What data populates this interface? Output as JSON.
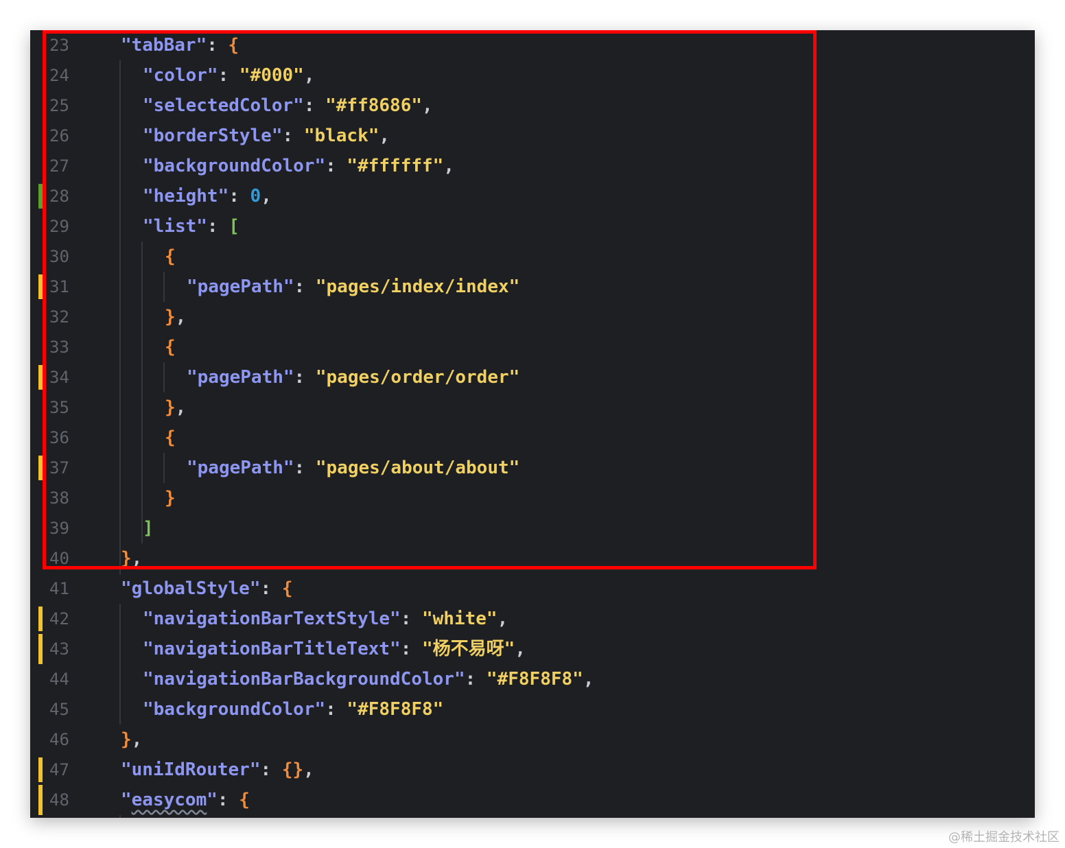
{
  "editor": {
    "lines": [
      {
        "num": "23",
        "indent": 0,
        "tokens": [
          {
            "t": "\"tabBar\"",
            "c": "k"
          },
          {
            "t": ": ",
            "c": "p"
          },
          {
            "t": "{",
            "c": "bc"
          }
        ]
      },
      {
        "num": "24",
        "indent": 1,
        "tokens": [
          {
            "t": "\"color\"",
            "c": "k"
          },
          {
            "t": ": ",
            "c": "p"
          },
          {
            "t": "\"#000\"",
            "c": "s"
          },
          {
            "t": ",",
            "c": "p"
          }
        ]
      },
      {
        "num": "25",
        "indent": 1,
        "tokens": [
          {
            "t": "\"selectedColor\"",
            "c": "k"
          },
          {
            "t": ": ",
            "c": "p"
          },
          {
            "t": "\"#ff8686\"",
            "c": "s"
          },
          {
            "t": ",",
            "c": "p"
          }
        ]
      },
      {
        "num": "26",
        "indent": 1,
        "tokens": [
          {
            "t": "\"borderStyle\"",
            "c": "k"
          },
          {
            "t": ": ",
            "c": "p"
          },
          {
            "t": "\"black\"",
            "c": "s"
          },
          {
            "t": ",",
            "c": "p"
          }
        ]
      },
      {
        "num": "27",
        "indent": 1,
        "tokens": [
          {
            "t": "\"backgroundColor\"",
            "c": "k"
          },
          {
            "t": ": ",
            "c": "p"
          },
          {
            "t": "\"#ffffff\"",
            "c": "s"
          },
          {
            "t": ",",
            "c": "p"
          }
        ]
      },
      {
        "num": "28",
        "indent": 1,
        "mark": "green",
        "tokens": [
          {
            "t": "\"height\"",
            "c": "k"
          },
          {
            "t": ": ",
            "c": "p"
          },
          {
            "t": "0",
            "c": "n"
          },
          {
            "t": ",",
            "c": "p"
          }
        ]
      },
      {
        "num": "29",
        "indent": 1,
        "tokens": [
          {
            "t": "\"list\"",
            "c": "k"
          },
          {
            "t": ": ",
            "c": "p"
          },
          {
            "t": "[",
            "c": "bs"
          }
        ]
      },
      {
        "num": "30",
        "indent": 2,
        "tokens": [
          {
            "t": "{",
            "c": "bc"
          }
        ]
      },
      {
        "num": "31",
        "indent": 3,
        "mark": "yellow",
        "tokens": [
          {
            "t": "\"pagePath\"",
            "c": "k"
          },
          {
            "t": ": ",
            "c": "p"
          },
          {
            "t": "\"pages/index/index\"",
            "c": "s"
          }
        ]
      },
      {
        "num": "32",
        "indent": 2,
        "tokens": [
          {
            "t": "}",
            "c": "bc"
          },
          {
            "t": ",",
            "c": "p"
          }
        ]
      },
      {
        "num": "33",
        "indent": 2,
        "tokens": [
          {
            "t": "{",
            "c": "bc"
          }
        ]
      },
      {
        "num": "34",
        "indent": 3,
        "mark": "yellow",
        "tokens": [
          {
            "t": "\"pagePath\"",
            "c": "k"
          },
          {
            "t": ": ",
            "c": "p"
          },
          {
            "t": "\"pages/order/order\"",
            "c": "s"
          }
        ]
      },
      {
        "num": "35",
        "indent": 2,
        "tokens": [
          {
            "t": "}",
            "c": "bc"
          },
          {
            "t": ",",
            "c": "p"
          }
        ]
      },
      {
        "num": "36",
        "indent": 2,
        "tokens": [
          {
            "t": "{",
            "c": "bc"
          }
        ]
      },
      {
        "num": "37",
        "indent": 3,
        "mark": "yellow",
        "tokens": [
          {
            "t": "\"pagePath\"",
            "c": "k"
          },
          {
            "t": ": ",
            "c": "p"
          },
          {
            "t": "\"pages/about/about\"",
            "c": "s"
          }
        ]
      },
      {
        "num": "38",
        "indent": 2,
        "tokens": [
          {
            "t": "}",
            "c": "bc"
          }
        ]
      },
      {
        "num": "39",
        "indent": 1,
        "tokens": [
          {
            "t": "]",
            "c": "bs"
          }
        ]
      },
      {
        "num": "40",
        "indent": 0,
        "tokens": [
          {
            "t": "}",
            "c": "bc"
          },
          {
            "t": ",",
            "c": "p"
          }
        ]
      },
      {
        "num": "41",
        "indent": 0,
        "tokens": [
          {
            "t": "\"globalStyle\"",
            "c": "k"
          },
          {
            "t": ": ",
            "c": "p"
          },
          {
            "t": "{",
            "c": "bc"
          }
        ]
      },
      {
        "num": "42",
        "indent": 1,
        "mark": "yellow",
        "tokens": [
          {
            "t": "\"navigationBarTextStyle\"",
            "c": "k"
          },
          {
            "t": ": ",
            "c": "p"
          },
          {
            "t": "\"white\"",
            "c": "s"
          },
          {
            "t": ",",
            "c": "p"
          }
        ]
      },
      {
        "num": "43",
        "indent": 1,
        "mark": "yellow-cont",
        "tokens": [
          {
            "t": "\"navigationBarTitleText\"",
            "c": "k"
          },
          {
            "t": ": ",
            "c": "p"
          },
          {
            "t": "\"杨不易呀\"",
            "c": "s"
          },
          {
            "t": ",",
            "c": "p"
          }
        ]
      },
      {
        "num": "44",
        "indent": 1,
        "tokens": [
          {
            "t": "\"navigationBarBackgroundColor\"",
            "c": "k"
          },
          {
            "t": ": ",
            "c": "p"
          },
          {
            "t": "\"#F8F8F8\"",
            "c": "s"
          },
          {
            "t": ",",
            "c": "p"
          }
        ]
      },
      {
        "num": "45",
        "indent": 1,
        "tokens": [
          {
            "t": "\"backgroundColor\"",
            "c": "k"
          },
          {
            "t": ": ",
            "c": "p"
          },
          {
            "t": "\"#F8F8F8\"",
            "c": "s"
          }
        ]
      },
      {
        "num": "46",
        "indent": 0,
        "tokens": [
          {
            "t": "}",
            "c": "bc"
          },
          {
            "t": ",",
            "c": "p"
          }
        ]
      },
      {
        "num": "47",
        "indent": 0,
        "mark": "yellow",
        "tokens": [
          {
            "t": "\"uniIdRouter\"",
            "c": "k"
          },
          {
            "t": ": ",
            "c": "p"
          },
          {
            "t": "{}",
            "c": "bc"
          },
          {
            "t": ",",
            "c": "p"
          }
        ]
      },
      {
        "num": "48",
        "indent": 0,
        "mark": "yellow-cont",
        "tokens": [
          {
            "t": "\"",
            "c": "k"
          },
          {
            "t": "easycom",
            "c": "k wavy"
          },
          {
            "t": "\"",
            "c": "k"
          },
          {
            "t": ": ",
            "c": "p"
          },
          {
            "t": "{",
            "c": "bc"
          }
        ]
      }
    ]
  },
  "watermark": "@稀土掘金技术社区",
  "colors": {
    "background": "#1e1f22",
    "key": "#8d97f2",
    "string": "#f0d062",
    "number": "#2f9bd9",
    "brace": "#f08c3c",
    "bracket": "#7ec25a",
    "highlight": "#ff0000"
  }
}
